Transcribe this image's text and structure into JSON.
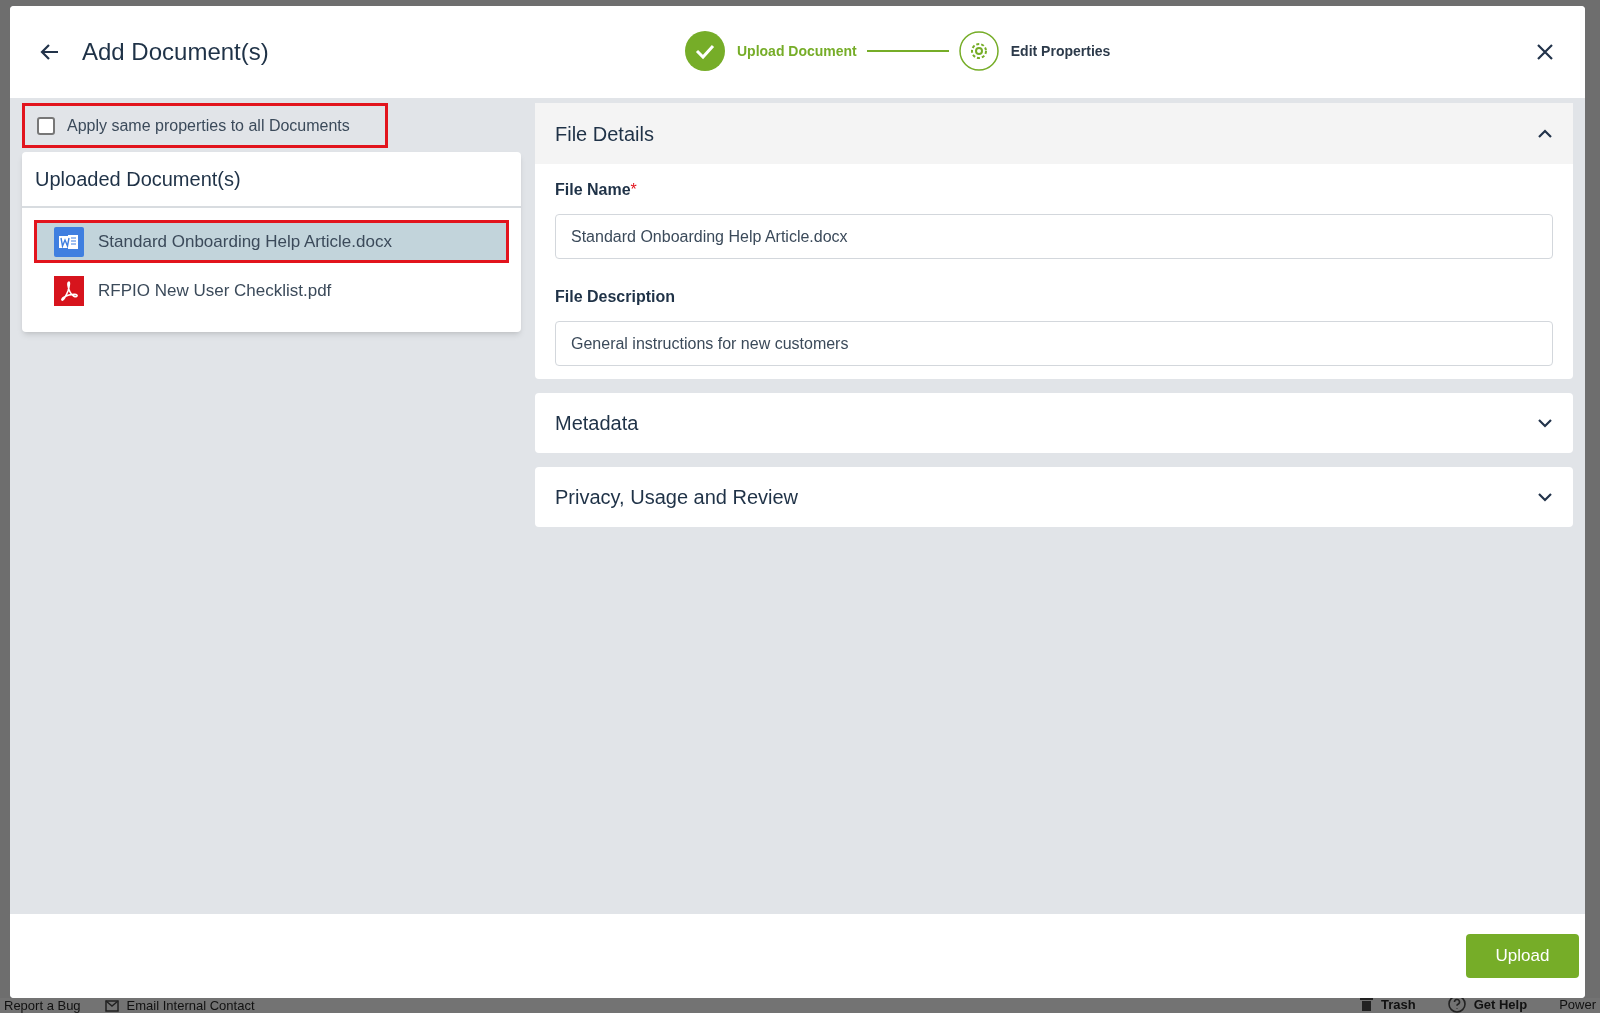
{
  "background_footer": {
    "left": [
      {
        "kind": "plain",
        "label": "Report a Bug"
      },
      {
        "kind": "mail",
        "label": "Email Internal Contact"
      }
    ],
    "right": [
      {
        "kind": "trash",
        "label": "Trash"
      },
      {
        "kind": "help",
        "label": "Get Help"
      },
      {
        "kind": "plain",
        "label": "Power"
      }
    ]
  },
  "dialog": {
    "title": "Add Document(s)",
    "steps": [
      {
        "label": "Upload Document",
        "done": true
      },
      {
        "label": "Edit Properties",
        "done": false
      }
    ],
    "apply_same": {
      "label": "Apply same properties to all Documents",
      "checked": false
    },
    "uploaded": {
      "title": "Uploaded Document(s)",
      "files": [
        {
          "name": "Standard Onboarding Help Article.docx",
          "kind": "word",
          "selected": true
        },
        {
          "name": "RFPIO New User Checklist.pdf",
          "kind": "pdf",
          "selected": false
        }
      ]
    },
    "sections": [
      {
        "title": "File Details",
        "expanded": true,
        "fields": [
          {
            "label": "File Name",
            "required_mark": "*",
            "value": "Standard Onboarding Help Article.docx"
          },
          {
            "label": "File Description",
            "value": "General instructions for new customers"
          }
        ]
      },
      {
        "title": "Metadata",
        "expanded": false
      },
      {
        "title": "Privacy, Usage and Review",
        "expanded": false
      }
    ],
    "upload_button": "Upload"
  }
}
